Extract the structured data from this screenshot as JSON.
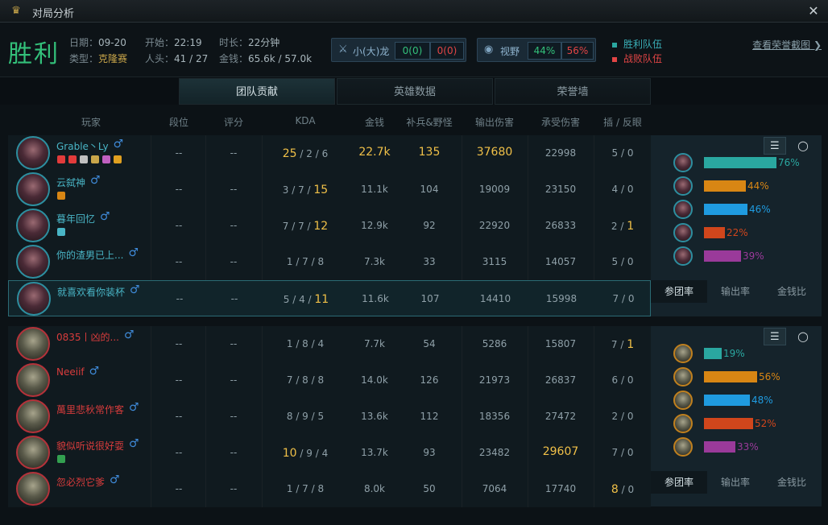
{
  "titlebar": {
    "title": "对局分析"
  },
  "summary": {
    "result": "胜利",
    "date_label": "日期：",
    "date": "09-20",
    "type_label": "类型：",
    "type": "克隆赛",
    "start_label": "开始：",
    "start": "22:19",
    "kills_label": "人头：",
    "kills": "41 / 27",
    "duration_label": "时长：",
    "duration": "22分钟",
    "gold_label": "金钱：",
    "gold": "65.6k / 57.0k",
    "dragon": {
      "label": "小(大)龙",
      "win": "0(0)",
      "lose": "0(0)"
    },
    "vision": {
      "label": "视野",
      "win": "44%",
      "lose": "56%"
    },
    "legend": {
      "win": "胜利队伍",
      "lose": "战败队伍"
    },
    "honor_link": "查看荣誉截图"
  },
  "colors": {
    "win": "#33c07a",
    "lose": "#e24545",
    "blue_name": "#49b5c6",
    "red_name": "#d93c3c",
    "gold": "#f0c048"
  },
  "tabs": [
    "团队贡献",
    "英雄数据",
    "荣誉墙"
  ],
  "columns": [
    "玩家",
    "段位",
    "评分",
    "KDA",
    "金钱",
    "补兵&野怪",
    "输出伤害",
    "承受伤害",
    "插 / 反眼"
  ],
  "teams": [
    {
      "players": [
        {
          "name": "Grable丶Ly",
          "rank": "--",
          "score": "--",
          "k": "25",
          "d": "2",
          "a": "6",
          "gold": "22.7k",
          "cs": "135",
          "dmg": "37680",
          "taken": "22998",
          "wp": "5",
          "wk": "0"
        },
        {
          "name": "云弑神",
          "rank": "--",
          "score": "--",
          "k": "3",
          "d": "7",
          "a": "15",
          "gold": "11.1k",
          "cs": "104",
          "dmg": "19009",
          "taken": "23150",
          "wp": "4",
          "wk": "0"
        },
        {
          "name": "暮年回忆",
          "rank": "--",
          "score": "--",
          "k": "7",
          "d": "7",
          "a": "12",
          "gold": "12.9k",
          "cs": "92",
          "dmg": "22920",
          "taken": "26833",
          "wp": "2",
          "wk": "1"
        },
        {
          "name": "你的渣男已上...",
          "rank": "--",
          "score": "--",
          "k": "1",
          "d": "7",
          "a": "8",
          "gold": "7.3k",
          "cs": "33",
          "dmg": "3115",
          "taken": "14057",
          "wp": "5",
          "wk": "0"
        },
        {
          "name": "就喜欢看你装杯",
          "rank": "--",
          "score": "--",
          "k": "5",
          "d": "4",
          "a": "11",
          "gold": "11.6k",
          "cs": "107",
          "dmg": "14410",
          "taken": "15998",
          "wp": "7",
          "wk": "0"
        }
      ],
      "participation": [
        {
          "label": "76%",
          "value": 76,
          "color": "#2aa7a0"
        },
        {
          "label": "44%",
          "value": 44,
          "color": "#d88614"
        },
        {
          "label": "46%",
          "value": 46,
          "color": "#1f9be0"
        },
        {
          "label": "22%",
          "value": 22,
          "color": "#d0461c"
        },
        {
          "label": "39%",
          "value": 39,
          "color": "#9a3a9a"
        }
      ]
    },
    {
      "players": [
        {
          "name": "0835丨凶的...",
          "rank": "--",
          "score": "--",
          "k": "1",
          "d": "8",
          "a": "4",
          "gold": "7.7k",
          "cs": "54",
          "dmg": "5286",
          "taken": "15807",
          "wp": "7",
          "wk": "1"
        },
        {
          "name": "Neeiif",
          "rank": "--",
          "score": "--",
          "k": "7",
          "d": "8",
          "a": "8",
          "gold": "14.0k",
          "cs": "126",
          "dmg": "21973",
          "taken": "26837",
          "wp": "6",
          "wk": "0"
        },
        {
          "name": "萬里悲秋常作客",
          "rank": "--",
          "score": "--",
          "k": "8",
          "d": "9",
          "a": "5",
          "gold": "13.6k",
          "cs": "112",
          "dmg": "18356",
          "taken": "27472",
          "wp": "2",
          "wk": "0"
        },
        {
          "name": "貌似听说很好耍",
          "rank": "--",
          "score": "--",
          "k": "10",
          "d": "9",
          "a": "4",
          "gold": "13.7k",
          "cs": "93",
          "dmg": "23482",
          "taken": "29607",
          "wp": "7",
          "wk": "0"
        },
        {
          "name": "忽必烈它爹",
          "rank": "--",
          "score": "--",
          "k": "1",
          "d": "7",
          "a": "8",
          "gold": "8.0k",
          "cs": "50",
          "dmg": "7064",
          "taken": "17740",
          "wp": "8",
          "wk": "0"
        }
      ],
      "participation": [
        {
          "label": "19%",
          "value": 19,
          "color": "#2aa7a0"
        },
        {
          "label": "56%",
          "value": 56,
          "color": "#d88614"
        },
        {
          "label": "48%",
          "value": 48,
          "color": "#1f9be0"
        },
        {
          "label": "52%",
          "value": 52,
          "color": "#d0461c"
        },
        {
          "label": "33%",
          "value": 33,
          "color": "#9a3a9a"
        }
      ]
    }
  ],
  "bottom_tabs": [
    "参团率",
    "输出率",
    "金钱比"
  ]
}
